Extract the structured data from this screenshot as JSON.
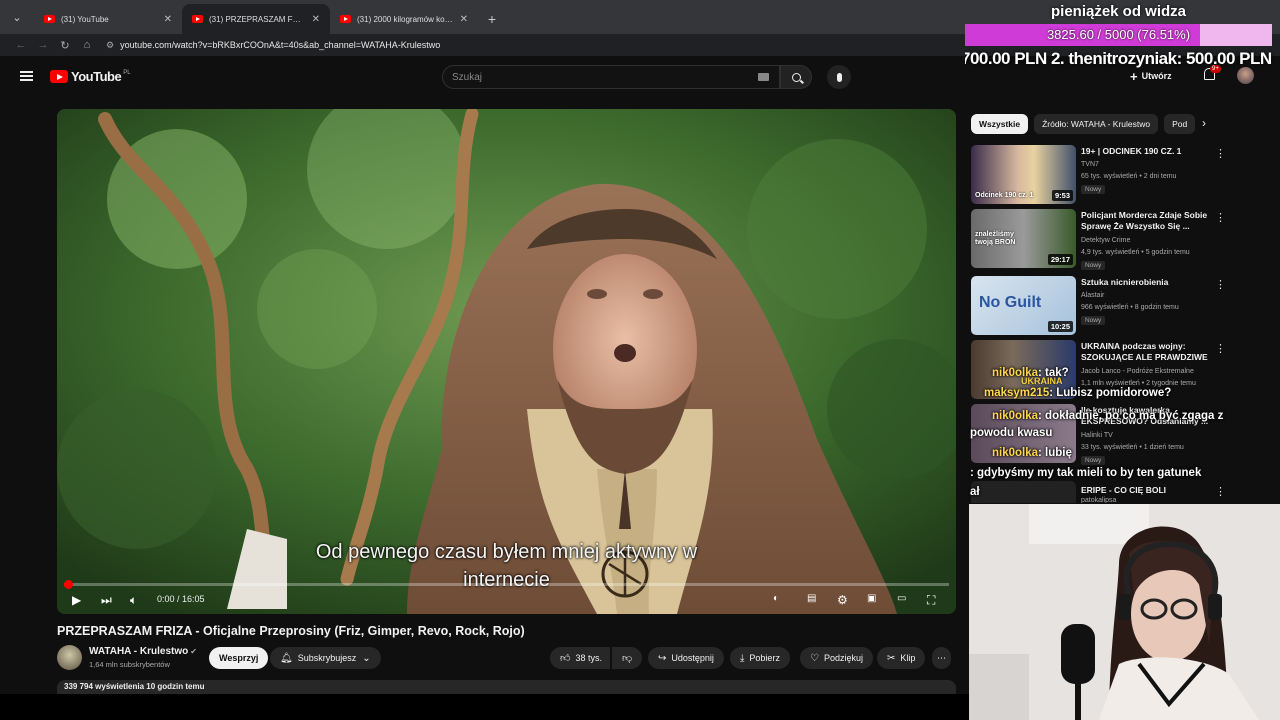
{
  "browser": {
    "tabs": [
      {
        "title": "(31) YouTube",
        "active": false
      },
      {
        "title": "(31) PRZEPRASZAM FRIZA - Oficjalne Przeprosiny",
        "active": true
      },
      {
        "title": "(31) 2000 kilogramów kokainy",
        "active": false
      }
    ],
    "url": "youtube.com/watch?v=bRKBxrCOOnA&t=40s&ab_channel=WATAHA-Krulestwo"
  },
  "header": {
    "logo": "YouTube",
    "country": "PL",
    "search_placeholder": "Szukaj",
    "create_label": "Utwórz",
    "notifications": "9+"
  },
  "player": {
    "caption_line1": "Od pewnego czasu byłem mniej aktywny w",
    "caption_line2": "internecie",
    "time": "0:00 / 16:05",
    "progress": 0.004
  },
  "video": {
    "title": "PRZEPRASZAM FRIZA - Oficjalne Przeprosiny (Friz, Gimper, Revo, Rock, Rojo)",
    "channel": "WATAHA - Krulestwo",
    "subscribers": "1,64 mln subskrybentów",
    "join_label": "Wesprzyj",
    "subscribe_label": "Subskrybujesz",
    "likes": "38 tys.",
    "share_label": "Udostępnij",
    "download_label": "Pobierz",
    "thanks_label": "Podziękuj",
    "clip_label": "Klip",
    "views_line": "339 794 wyświetlenia  10 godzin temu"
  },
  "chips": [
    "Wszystkie",
    "Źródło: WATAHA - Krulestwo",
    "Pod"
  ],
  "recommendations": [
    {
      "title": "19+ | ODCINEK 190 CZ. 1",
      "channel": "TVN7",
      "meta": "65 tys. wyświetleń • 2 dni temu",
      "badge": "Nowy",
      "duration": "9:53",
      "thumb_text": "Odcinek 190 cz. 1"
    },
    {
      "title": "Policjant Morderca Zdaje Sobie Sprawę Że Wszystko Się ...",
      "channel": "Detektyw Crime",
      "meta": "4,9 tys. wyświetleń • 5 godzin temu",
      "badge": "Nowy",
      "duration": "29:17",
      "thumb_text": "znaleźliśmy twoją BROŃ"
    },
    {
      "title": "Sztuka nicnierobienia",
      "channel": "Alastair",
      "meta": "966 wyświetleń • 8 godzin temu",
      "badge": "Nowy",
      "duration": "10:25",
      "thumb_text": "No Guilt"
    },
    {
      "title": "UKRAINA podczas wojny: SZOKUJĄCE ALE PRAWDZIWE",
      "channel": "Jacob Lanco - Podróże Ekstremalne",
      "meta": "1,1 mln wyświetleń • 2 tygodnie temu",
      "badge": "",
      "duration": "",
      "thumb_text": "UKRAINA"
    },
    {
      "title": "Ile kosztuje kawalerka EKSPRESOWO? Odsłaniamy ...",
      "channel": "Halinki TV",
      "meta": "33 tys. wyświetleń • 1 dzień temu",
      "badge": "Nowy",
      "duration": "",
      "thumb_text": ""
    },
    {
      "title": "ERIPE - CO CIĘ BOLI",
      "channel": "patokalipsa",
      "meta": "",
      "badge": "",
      "duration": "",
      "thumb_text": ""
    }
  ],
  "stream": {
    "donation_title": "pieniążek od widza",
    "donation_text": "3825.60 / 5000 (76.51%)",
    "donation_fraction": 0.7651,
    "ticker": "700.00 PLN    2. thenitrozyniak: 500.00 PLN",
    "chat": [
      {
        "nick": "nik0olka",
        "msg": ": tak?"
      },
      {
        "nick": "maksym215",
        "msg": ": Lubisz pomidorowe?"
      },
      {
        "nick": "nik0olka",
        "msg": ": dokładnie, po co ma być zgaga z powodu kwasu"
      },
      {
        "nick": "nik0olka",
        "msg": ": lubię"
      },
      {
        "nick": "",
        "msg": ": gdybyśmy my tak mieli to by ten gatunek"
      },
      {
        "nick": "",
        "msg": "ał"
      }
    ]
  },
  "colors": {
    "accent": "#ff0000",
    "background": "#0f0f0f",
    "donation_fill": "#cf3bd6",
    "donation_track": "#f0b6ee"
  }
}
